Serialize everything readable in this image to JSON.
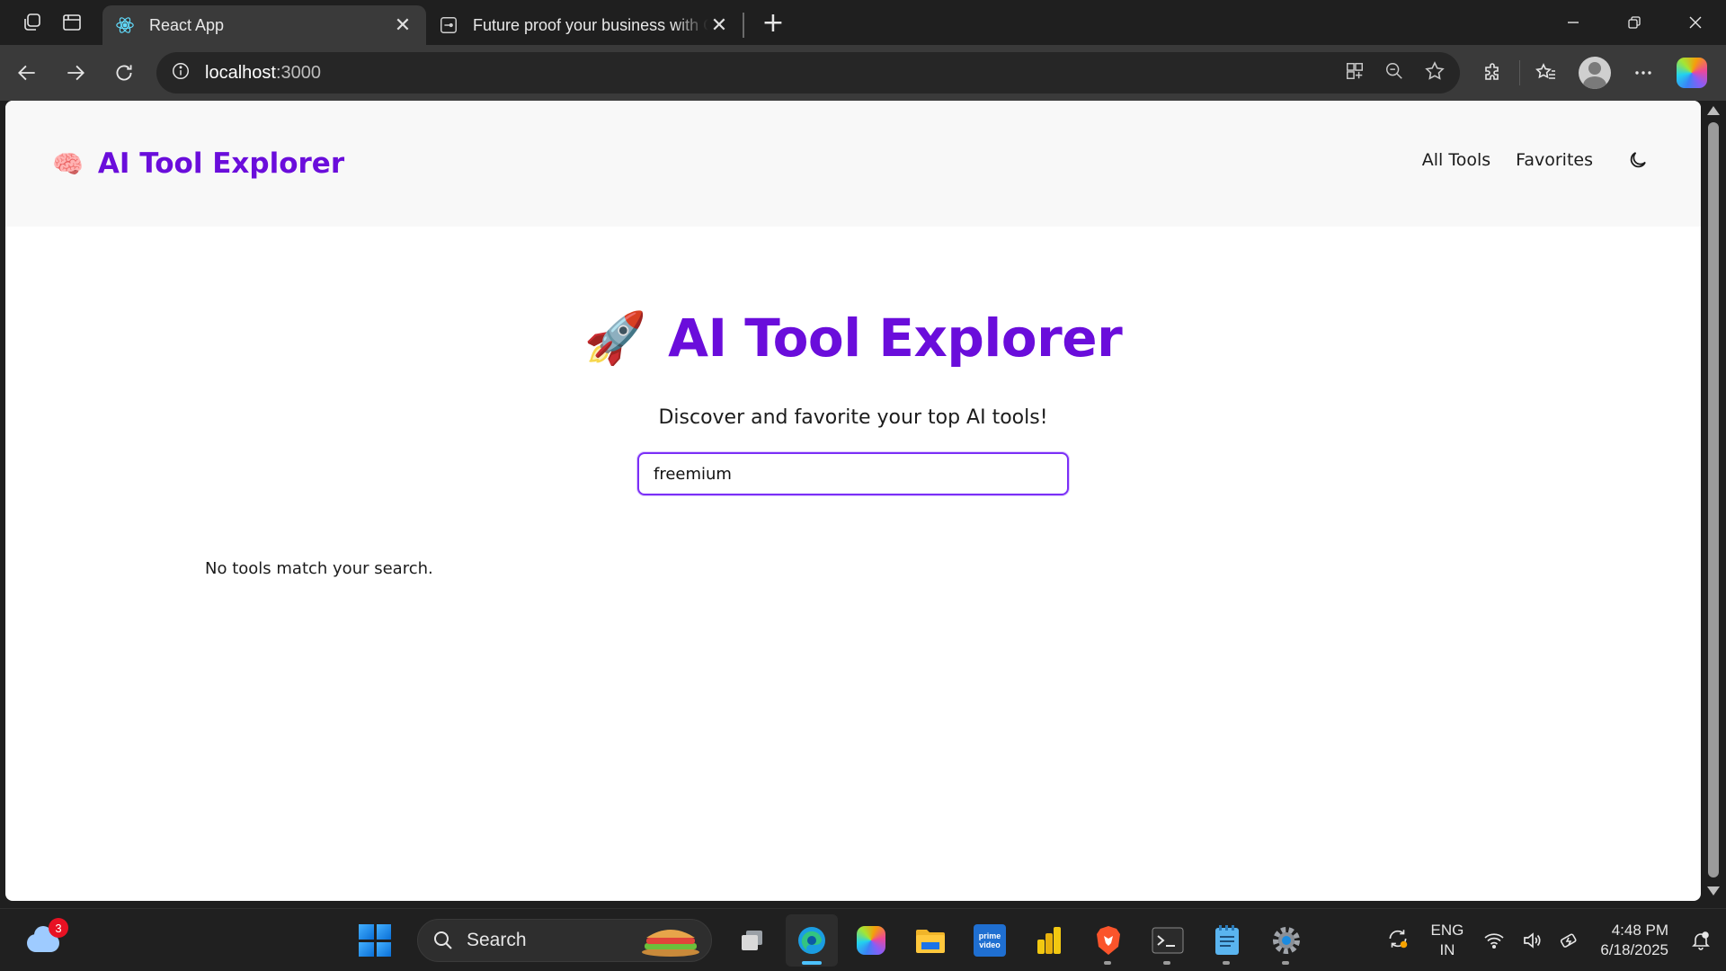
{
  "browser": {
    "tabs": [
      {
        "title": "React App",
        "active": true,
        "favicon": "react-icon"
      },
      {
        "title": "Future proof your business with G",
        "active": false,
        "favicon": "page-icon"
      }
    ],
    "address": {
      "host": "localhost",
      "port": ":3000"
    }
  },
  "app": {
    "brand": {
      "emoji": "🧠",
      "title": "AI Tool Explorer"
    },
    "nav": {
      "all_tools": "All Tools",
      "favorites": "Favorites"
    },
    "hero": {
      "emoji": "🚀",
      "title": "AI Tool Explorer",
      "tagline": "Discover and favorite your top AI tools!"
    },
    "search": {
      "value": "freemium"
    },
    "empty_message": "No tools match your search."
  },
  "taskbar": {
    "weather_badge": "3",
    "search_label": "Search",
    "language": {
      "line1": "ENG",
      "line2": "IN"
    },
    "clock": {
      "time": "4:48 PM",
      "date": "6/18/2025"
    }
  },
  "colors": {
    "brand_purple": "#6a0ddb",
    "input_border": "#7b2ff7",
    "browser_chrome": "#3a3a3a",
    "taskbar_bg": "#202020"
  }
}
